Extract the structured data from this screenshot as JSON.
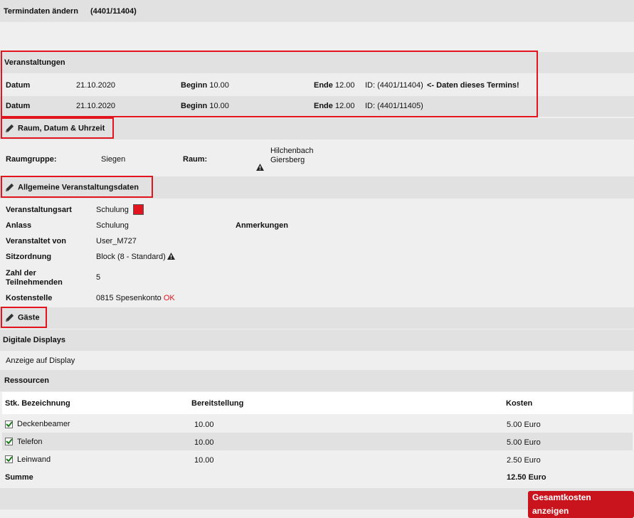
{
  "header": {
    "title": "Termindaten ändern",
    "id": "(4401/11404)"
  },
  "veranstaltungen": {
    "title": "Veranstaltungen",
    "rows": [
      {
        "datum_label": "Datum",
        "datum": "21.10.2020",
        "beginn_label": "Beginn",
        "beginn": "10.00",
        "ende_label": "Ende",
        "ende": "12.00",
        "id": "ID: (4401/11404)",
        "note": "<- Daten dieses Termins!"
      },
      {
        "datum_label": "Datum",
        "datum": "21.10.2020",
        "beginn_label": "Beginn",
        "beginn": "10.00",
        "ende_label": "Ende",
        "ende": "12.00",
        "id": "ID: (4401/11405)",
        "note": ""
      }
    ]
  },
  "raum": {
    "title": "Raum, Datum & Uhrzeit",
    "raumgruppe_label": "Raumgruppe:",
    "raumgruppe": "Siegen",
    "raum_label": "Raum:",
    "raum_line1": "Hilchenbach",
    "raum_line2": "Giersberg"
  },
  "allgemein": {
    "title": "Allgemeine Veranstaltungsdaten",
    "art_label": "Veranstaltungsart",
    "art": "Schulung",
    "art_color": "#e2141e",
    "anlass_label": "Anlass",
    "anlass": "Schulung",
    "anmerkungen_label": "Anmerkungen",
    "veranstaltet_label": "Veranstaltet von",
    "veranstaltet": "User_M727",
    "sitz_label": "Sitzordnung",
    "sitz": "Block (8 - Standard)",
    "zahl_label_1": "Zahl der",
    "zahl_label_2": "Teilnehmenden",
    "zahl": "5",
    "kosten_label": "Kostenstelle",
    "kosten": "0815 Spesenkonto",
    "kosten_status": "OK"
  },
  "gaeste": {
    "title": "Gäste"
  },
  "displays": {
    "title": "Digitale Displays",
    "text": "Anzeige auf Display"
  },
  "ressourcen": {
    "title": "Ressourcen",
    "col_bez": "Stk. Bezeichnung",
    "col_bereit": "Bereitstellung",
    "col_kosten": "Kosten",
    "items": [
      {
        "name": "Deckenbeamer",
        "bereit": "10.00",
        "kosten": "5.00 Euro"
      },
      {
        "name": "Telefon",
        "bereit": "10.00",
        "kosten": "5.00 Euro"
      },
      {
        "name": "Leinwand",
        "bereit": "10.00",
        "kosten": "2.50 Euro"
      }
    ],
    "summe_label": "Summe",
    "summe": "12.50 Euro",
    "button": "Gesamtkosten anzeigen"
  },
  "colors": {
    "highlight": "#e2141e",
    "button": "#c9141d"
  }
}
